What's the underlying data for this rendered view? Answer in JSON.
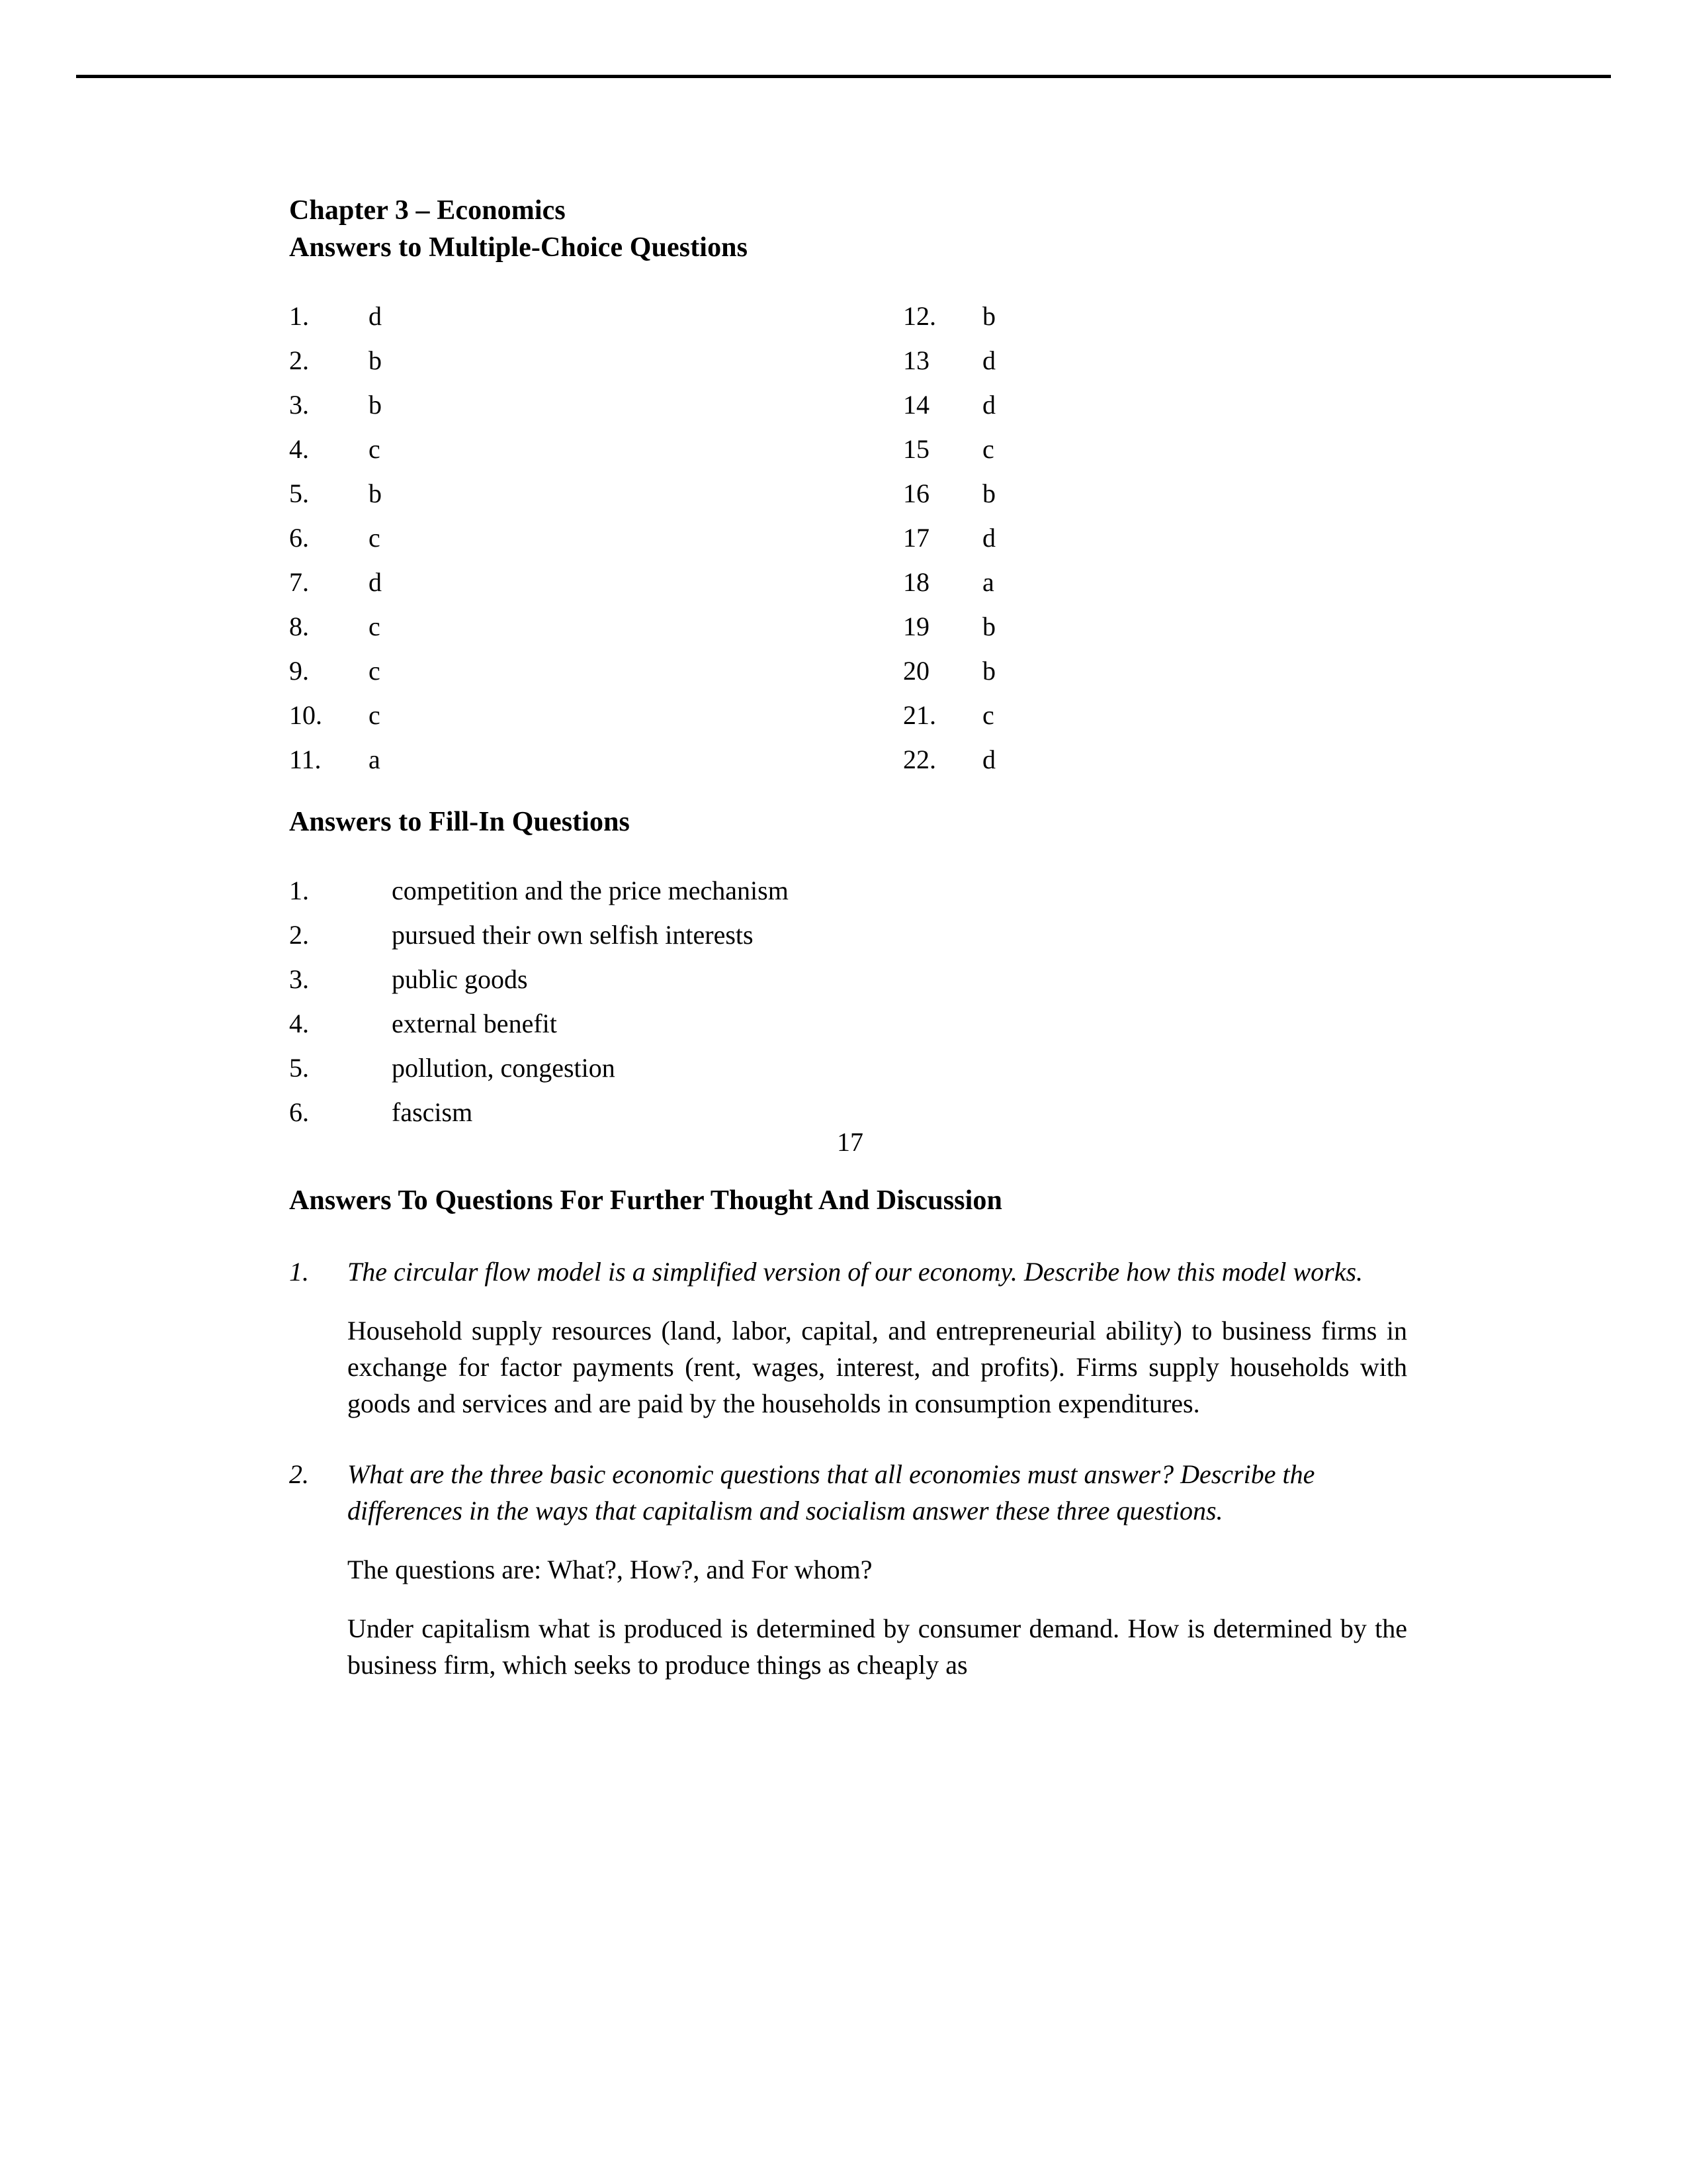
{
  "document": {
    "title_line_1": "Chapter 3 – Economics",
    "title_line_2": "Answers to Multiple-Choice Questions",
    "page_number": "17"
  },
  "multiple_choice": {
    "left_column": [
      {
        "number": "1.",
        "answer": "d"
      },
      {
        "number": "2.",
        "answer": "b"
      },
      {
        "number": "3.",
        "answer": "b"
      },
      {
        "number": "4.",
        "answer": "c"
      },
      {
        "number": "5.",
        "answer": "b"
      },
      {
        "number": "6.",
        "answer": "c"
      },
      {
        "number": "7.",
        "answer": "d"
      },
      {
        "number": "8.",
        "answer": "c"
      },
      {
        "number": "9.",
        "answer": "c"
      },
      {
        "number": "10.",
        "answer": "c"
      },
      {
        "number": "11.",
        "answer": "a"
      }
    ],
    "right_column": [
      {
        "number": "12.",
        "answer": "b"
      },
      {
        "number": "13",
        "answer": "d"
      },
      {
        "number": "14",
        "answer": "d"
      },
      {
        "number": "15",
        "answer": "c"
      },
      {
        "number": "16",
        "answer": "b"
      },
      {
        "number": "17",
        "answer": "d"
      },
      {
        "number": "18",
        "answer": "a"
      },
      {
        "number": "19",
        "answer": "b"
      },
      {
        "number": "20",
        "answer": "b"
      },
      {
        "number": "21.",
        "answer": "c"
      },
      {
        "number": "22.",
        "answer": "d"
      }
    ]
  },
  "fill_in": {
    "heading": "Answers to Fill-In Questions",
    "items": [
      {
        "number": "1.",
        "text": "competition and the price mechanism"
      },
      {
        "number": "2.",
        "text": "pursued their own selfish interests"
      },
      {
        "number": "3.",
        "text": "public goods"
      },
      {
        "number": "4.",
        "text": "external benefit"
      },
      {
        "number": "5.",
        "text": "pollution, congestion"
      },
      {
        "number": "6.",
        "text": "fascism"
      }
    ]
  },
  "discussion": {
    "heading": "Answers To Questions For Further Thought And Discussion",
    "items": [
      {
        "number": "1.",
        "question": "The circular flow model is a simplified version of our economy. Describe how this model works.",
        "answers": [
          "Household supply resources (land, labor, capital, and entrepreneurial ability) to business firms in exchange for factor payments (rent, wages, interest, and profits). Firms supply households with goods and services and are paid by the households in consumption expenditures."
        ]
      },
      {
        "number": "2.",
        "question": "What are the three basic economic questions that all economies must answer? Describe the differences in the ways that capitalism and socialism answer these three questions.",
        "answers": [
          "The questions are: What?, How?, and For whom?",
          "Under capitalism what is produced is determined by consumer demand. How is determined by the business firm, which seeks to produce things as cheaply as"
        ]
      }
    ]
  }
}
